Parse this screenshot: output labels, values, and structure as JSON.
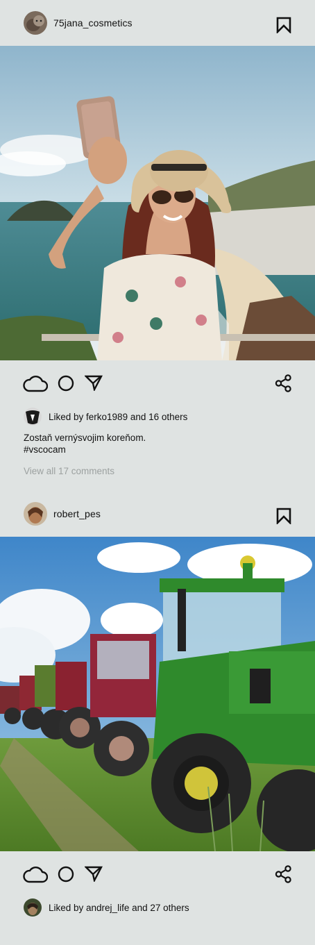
{
  "posts": [
    {
      "username": "75jana_cosmetics",
      "likes_text": "Liked by ferko1989 and 16 others",
      "caption_line1": "Zostaň vernýsvojim koreňom.",
      "caption_line2": "#vscocam",
      "view_comments": "View all 17 comments"
    },
    {
      "username": "robert_pes",
      "likes_text": "Liked by andrej_life and 27 others"
    }
  ],
  "icons": {
    "bookmark": "bookmark-icon",
    "like": "cloud-icon",
    "comment": "circle-icon",
    "send": "send-icon",
    "share": "share-icon"
  },
  "colors": {
    "background": "#dfe3e2",
    "text": "#111111",
    "muted": "#9ca1a0"
  }
}
